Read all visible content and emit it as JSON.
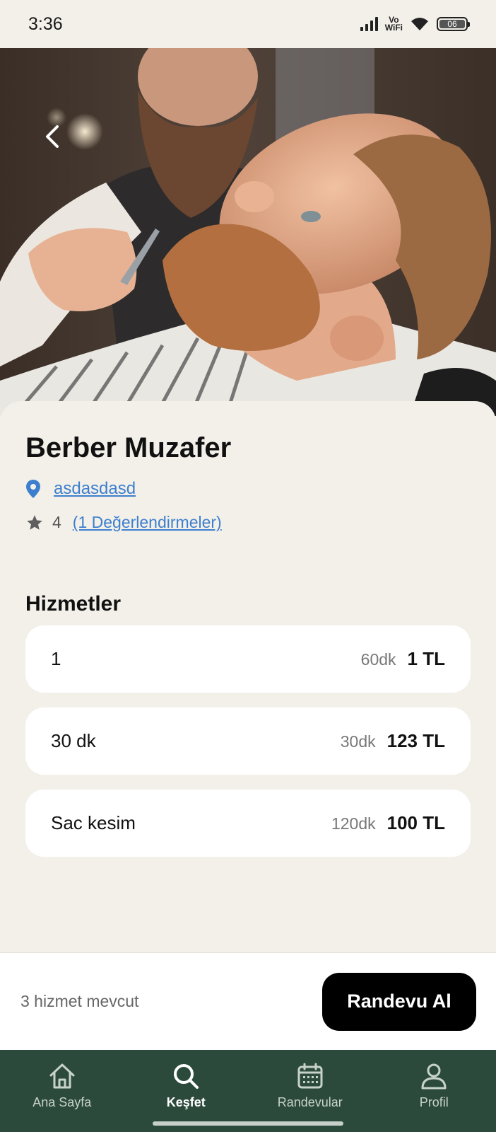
{
  "status_bar": {
    "time": "3:36",
    "network_label_top": "Vo",
    "network_label_bottom": "WiFi",
    "battery": "06"
  },
  "hero": {
    "image_icon": "barber-photo",
    "back_icon": "chevron-left-icon"
  },
  "shop": {
    "name": "Berber Muzafer",
    "location": "asdasdasd",
    "rating": "4",
    "reviews_link": "(1 Değerlendirmeler)"
  },
  "services_section": {
    "title": "Hizmetler",
    "items": [
      {
        "name": "1",
        "duration": "60dk",
        "price": "1 TL"
      },
      {
        "name": "30 dk",
        "duration": "30dk",
        "price": "123 TL"
      },
      {
        "name": "Sac kesim",
        "duration": "120dk",
        "price": "100 TL"
      }
    ]
  },
  "booking": {
    "available_text": "3 hizmet mevcut",
    "button_label": "Randevu Al"
  },
  "bottom_nav": {
    "items": [
      {
        "label": "Ana Sayfa",
        "icon": "home-icon"
      },
      {
        "label": "Keşfet",
        "icon": "search-icon"
      },
      {
        "label": "Randevular",
        "icon": "calendar-icon"
      },
      {
        "label": "Profil",
        "icon": "profile-icon"
      }
    ],
    "active": "Keşfet"
  },
  "colors": {
    "background": "#f3f0ea",
    "link": "#3d7fce",
    "nav_bg": "#2c4a3c",
    "button_bg": "#000000"
  }
}
